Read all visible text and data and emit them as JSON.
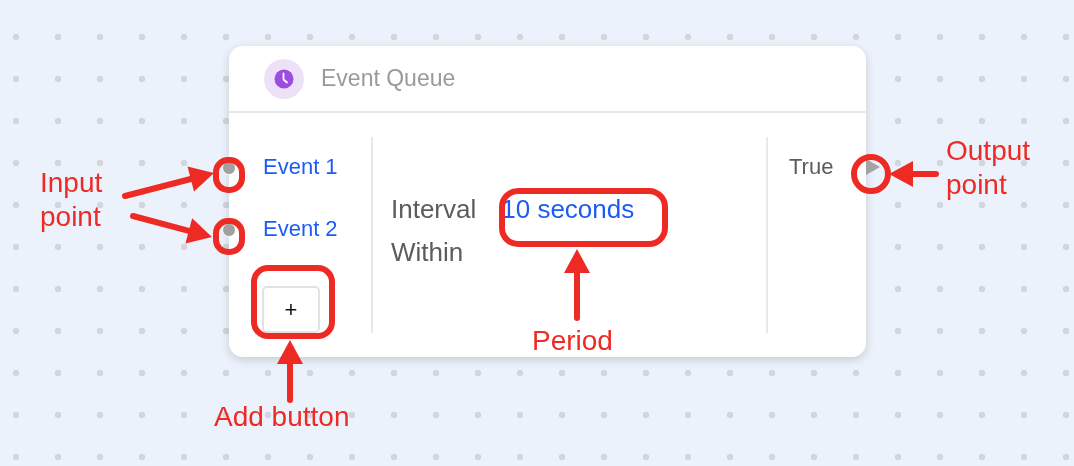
{
  "canvas": {
    "node": {
      "title": "Event Queue",
      "inputs": [
        {
          "label": "Event 1"
        },
        {
          "label": "Event 2"
        }
      ],
      "add_button": "+",
      "fields": [
        {
          "label": "Interval",
          "value": "10 seconds"
        },
        {
          "label": "Within"
        }
      ],
      "outputs": [
        {
          "label": "True"
        }
      ]
    }
  },
  "annotations": [
    {
      "text": "Input point"
    },
    {
      "text": "Add button"
    },
    {
      "text": "Period"
    },
    {
      "text": "Output point"
    }
  ]
}
